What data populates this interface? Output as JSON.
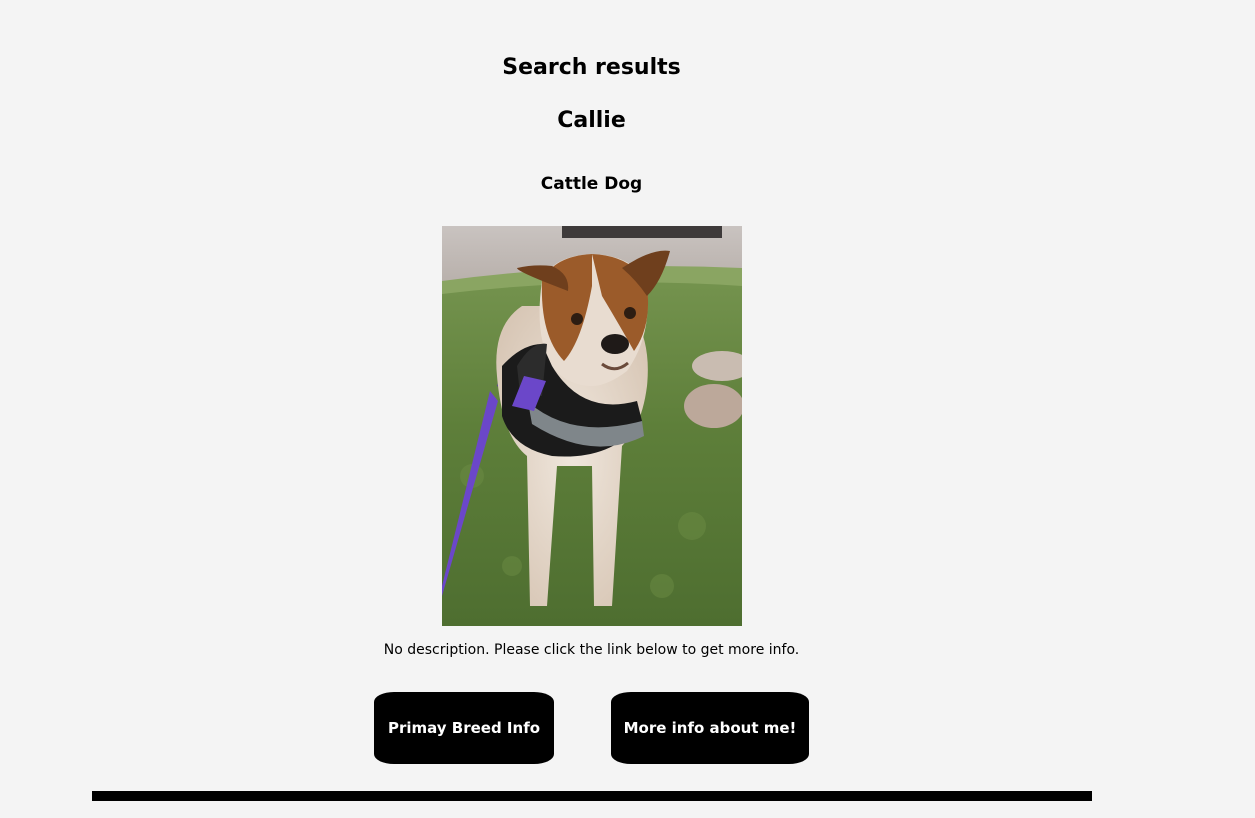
{
  "page": {
    "title": "Search results"
  },
  "pet": {
    "name": "Callie",
    "breed": "Cattle Dog",
    "description": "No description. Please click the link below to get more info."
  },
  "buttons": {
    "breed_info": "Primay Breed Info",
    "more_info": "More info about me!"
  },
  "colors": {
    "background": "#f4f4f4",
    "button_bg": "#000000",
    "button_text": "#ffffff",
    "text": "#000000"
  }
}
